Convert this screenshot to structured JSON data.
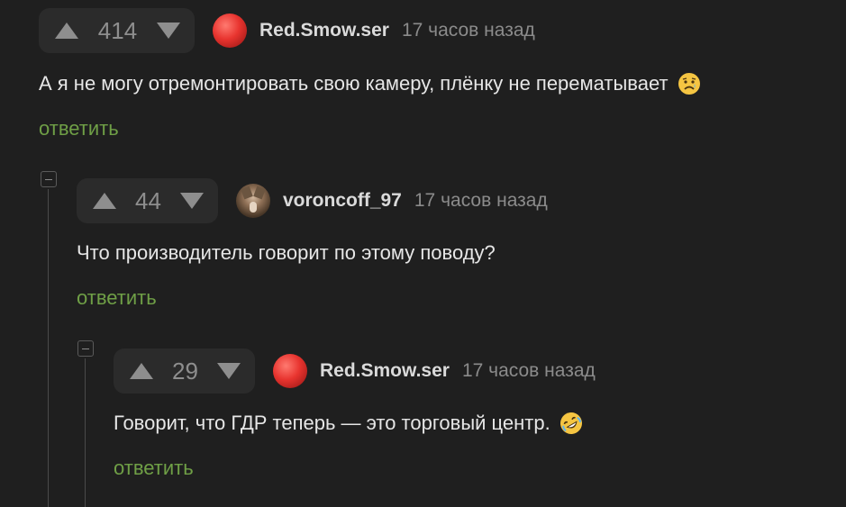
{
  "comments": [
    {
      "rating": "414",
      "username": "Red.Smow.ser",
      "time": "17 часов назад",
      "text": "А я не могу отремонтировать свою камеру, плёнку не перематывает",
      "emoji": "sad-face-emoji",
      "reply_label": "ответить",
      "avatar": "red-sphere"
    },
    {
      "rating": "44",
      "username": "voroncoff_97",
      "time": "17 часов назад",
      "text": "Что производитель говорит по этому поводу?",
      "reply_label": "ответить",
      "avatar": "wolf"
    },
    {
      "rating": "29",
      "username": "Red.Smow.ser",
      "time": "17 часов назад",
      "text": "Говорит, что ГДР теперь — это торговый центр.",
      "emoji": "rofl-emoji",
      "reply_label": "ответить",
      "avatar": "red-sphere"
    }
  ],
  "colors": {
    "background": "#1f1f1f",
    "rating_bg": "#2b2b2b",
    "reply_link": "#6f9f46",
    "muted": "#8b8b8b"
  }
}
